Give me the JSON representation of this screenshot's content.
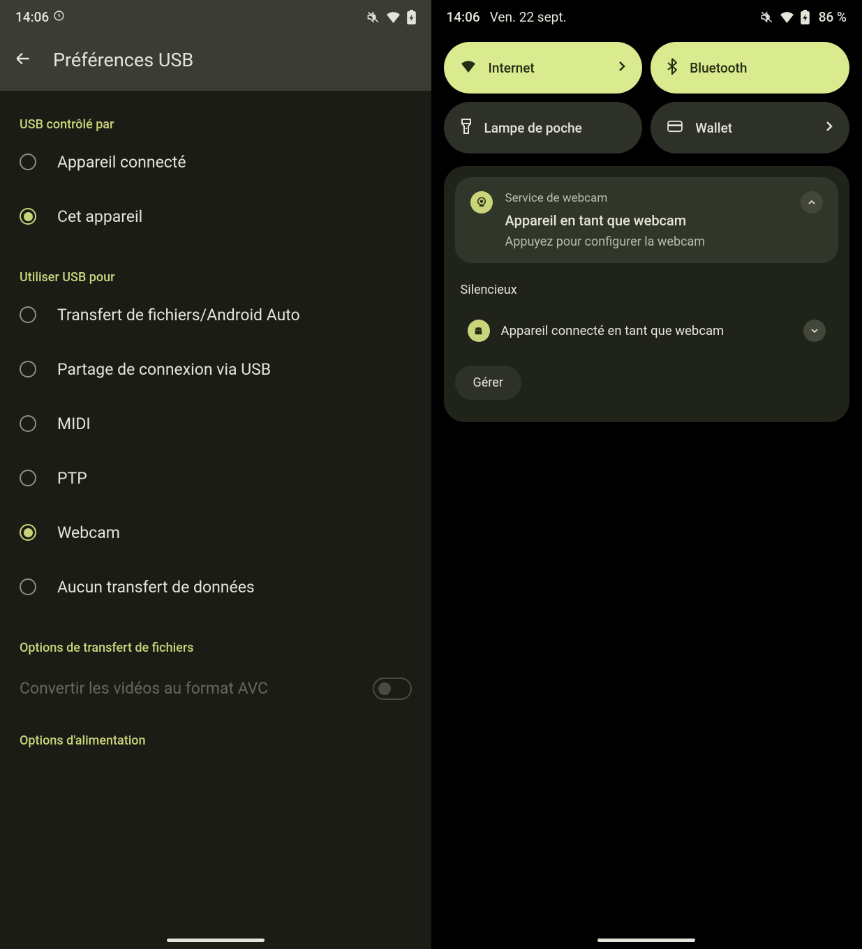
{
  "left": {
    "statusbar": {
      "time": "14:06"
    },
    "header": {
      "title": "Préférences USB"
    },
    "section1_title": "USB contrôlé par",
    "radios1": [
      {
        "label": "Appareil connecté",
        "checked": false
      },
      {
        "label": "Cet appareil",
        "checked": true
      }
    ],
    "section2_title": "Utiliser USB pour",
    "radios2": [
      {
        "label": "Transfert de fichiers/Android Auto",
        "checked": false
      },
      {
        "label": "Partage de connexion via USB",
        "checked": false
      },
      {
        "label": "MIDI",
        "checked": false
      },
      {
        "label": "PTP",
        "checked": false
      },
      {
        "label": "Webcam",
        "checked": true
      },
      {
        "label": "Aucun transfert de données",
        "checked": false
      }
    ],
    "section3_title": "Options de transfert de fichiers",
    "toggle_label": "Convertir les vidéos au format AVC",
    "section4_title": "Options d'alimentation"
  },
  "right": {
    "statusbar": {
      "time": "14:06",
      "date": "Ven. 22 sept.",
      "battery_pct": "86 %"
    },
    "tiles": [
      {
        "name": "internet",
        "label": "Internet",
        "active": true,
        "chevron": true
      },
      {
        "name": "bluetooth",
        "label": "Bluetooth",
        "active": true,
        "chevron": false
      },
      {
        "name": "flashlight",
        "label": "Lampe de poche",
        "active": false,
        "chevron": false
      },
      {
        "name": "wallet",
        "label": "Wallet",
        "active": false,
        "chevron": true
      }
    ],
    "notif": {
      "app": "Service de webcam",
      "title": "Appareil en tant que webcam",
      "sub": "Appuyez pour configurer la webcam"
    },
    "silent_label": "Silencieux",
    "notif2": {
      "label": "Appareil connecté en tant que webcam"
    },
    "manage_label": "Gérer"
  }
}
